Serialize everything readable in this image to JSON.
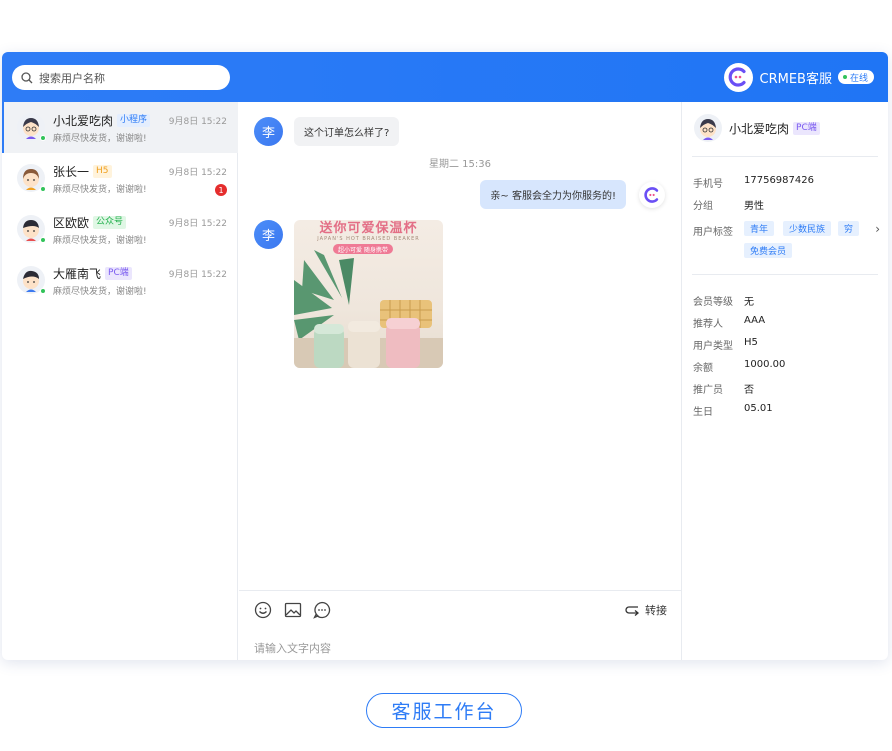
{
  "search": {
    "placeholder": "搜索用户名称"
  },
  "brand": {
    "name": "CRMEB客服",
    "status": "在线",
    "accent": "#2e7cf6"
  },
  "conversations": [
    {
      "name": "小北爱吃肉",
      "tag": "小程序",
      "tag_type": "mini",
      "time": "9月8日 15:22",
      "preview": "麻烦尽快发货，谢谢啦!",
      "unread": ""
    },
    {
      "name": "张长一",
      "tag": "H5",
      "tag_type": "h5",
      "time": "9月8日 15:22",
      "preview": "麻烦尽快发货，谢谢啦!",
      "unread": "1"
    },
    {
      "name": "区欧欧",
      "tag": "公众号",
      "tag_type": "gzh",
      "time": "9月8日 15:22",
      "preview": "麻烦尽快发货，谢谢啦!",
      "unread": ""
    },
    {
      "name": "大雁南飞",
      "tag": "PC端",
      "tag_type": "pc",
      "time": "9月8日 15:22",
      "preview": "麻烦尽快发货，谢谢啦!",
      "unread": ""
    }
  ],
  "chat": {
    "user_avatar_char": "李",
    "msg1": "这个订单怎么样了?",
    "timestamp": "星期二 15:36",
    "reply": "亲~ 客服会全力为你服务的!",
    "image_title": "送你可爱保温杯",
    "image_subtitle": "JAPAN'S HOT BRAISED BEAKER",
    "image_pill": "超小可爱 随身携带",
    "transfer": "转接",
    "input_placeholder": "请输入文字内容"
  },
  "profile": {
    "name": "小北爱吃肉",
    "tag": "PC端",
    "phone_label": "手机号",
    "phone": "17756987426",
    "group_label": "分组",
    "group": "男性",
    "tags_label": "用户标签",
    "tags": [
      "青年",
      "少数民族",
      "穷",
      "免费会员"
    ],
    "details": [
      {
        "k": "会员等级",
        "v": "无"
      },
      {
        "k": "推荐人",
        "v": "AAA"
      },
      {
        "k": "用户类型",
        "v": "H5"
      },
      {
        "k": "余额",
        "v": "1000.00"
      },
      {
        "k": "推广员",
        "v": "否"
      },
      {
        "k": "生日",
        "v": "05.01"
      }
    ]
  },
  "footer": {
    "button": "客服工作台"
  }
}
